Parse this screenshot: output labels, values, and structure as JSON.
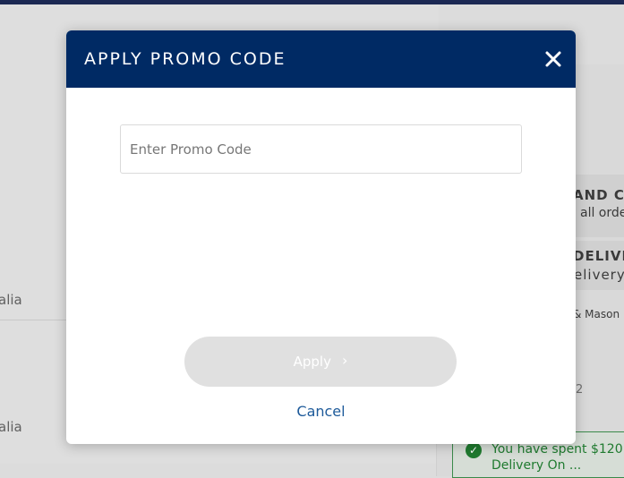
{
  "background": {
    "left_texts": [
      "alia",
      "alia"
    ],
    "right_texts": {
      "heading_1": "AND CO",
      "sub_1": "all orde",
      "heading_2": "DELIVE",
      "sub_2": "elivery",
      "brand": "& Mason",
      "digit": "2",
      "notice_line_1": "You have spent $120",
      "notice_line_2": "Delivery On ..."
    }
  },
  "modal": {
    "title": "APPLY PROMO CODE",
    "close_label": "×",
    "promo_input": {
      "value": "",
      "placeholder": "Enter Promo Code"
    },
    "apply_label": "Apply",
    "apply_chevron": "›",
    "cancel_label": "Cancel"
  },
  "colors": {
    "header": "#002a64",
    "apply_disabled": "#e0e0e0",
    "cancel_link": "#1d5a9a"
  }
}
